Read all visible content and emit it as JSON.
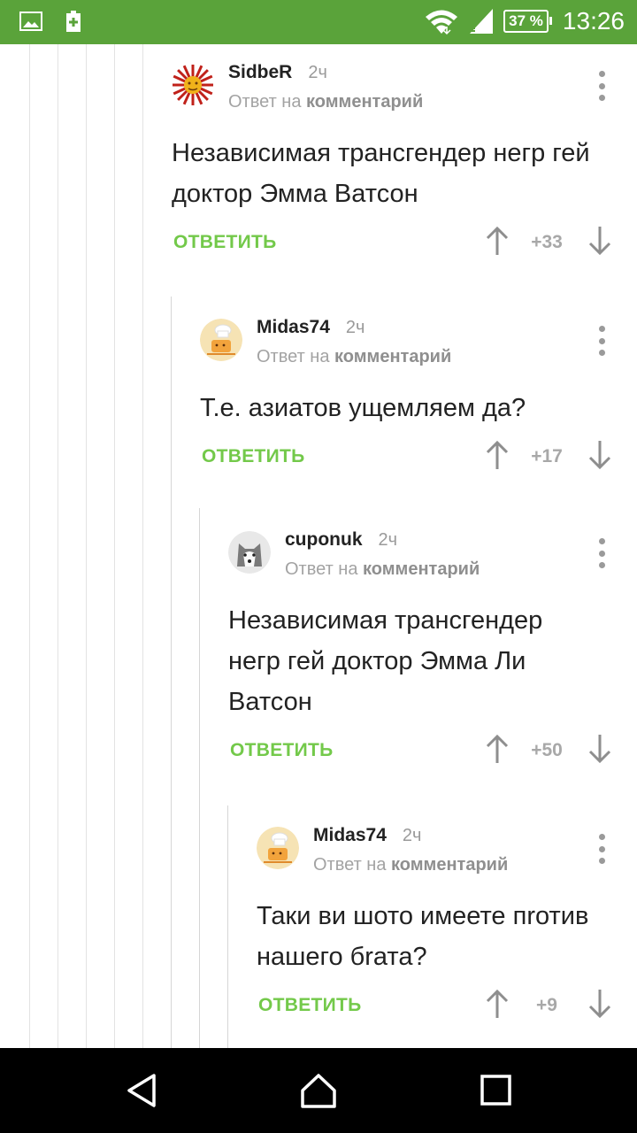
{
  "status_bar": {
    "battery": "37 %",
    "time": "13:26"
  },
  "comments": [
    {
      "author": "SidbeR",
      "time": "2ч",
      "reply_prefix": "Ответ на",
      "reply_link": "комментарий",
      "text": "Независимая трансгендер негр гей доктор Эмма Ватсон",
      "reply_label": "ОТВЕТИТЬ",
      "score": "+33"
    },
    {
      "author": "Midas74",
      "time": "2ч",
      "reply_prefix": "Ответ на",
      "reply_link": "комментарий",
      "text": "Т.е. азиатов ущемляем да?",
      "reply_label": "ОТВЕТИТЬ",
      "score": "+17"
    },
    {
      "author": "cuponuk",
      "time": "2ч",
      "reply_prefix": "Ответ на",
      "reply_link": "комментарий",
      "text": "Независимая трансгендер негр гей доктор Эмма Ли Ватсон",
      "reply_label": "ОТВЕТИТЬ",
      "score": "+50"
    },
    {
      "author": "Midas74",
      "time": "2ч",
      "reply_prefix": "Ответ на",
      "reply_link": "комментарий",
      "text": "Таки ви шото имеете пrотив нашего бrата?",
      "reply_label": "ОТВЕТИТЬ",
      "score": "+9"
    }
  ],
  "colors": {
    "status_bar": "#5aa33a",
    "reply_button": "#73c94a",
    "nav_bar": "#000000"
  },
  "icons": {
    "status_left": [
      "image-notification-icon",
      "battery-saver-icon"
    ],
    "status_right": [
      "wifi-icon",
      "signal-icon"
    ],
    "vote_up": "arrow-up-icon",
    "vote_down": "arrow-down-icon",
    "menu": "more-vertical-icon",
    "nav": [
      "back-icon",
      "home-icon",
      "recents-icon"
    ]
  }
}
